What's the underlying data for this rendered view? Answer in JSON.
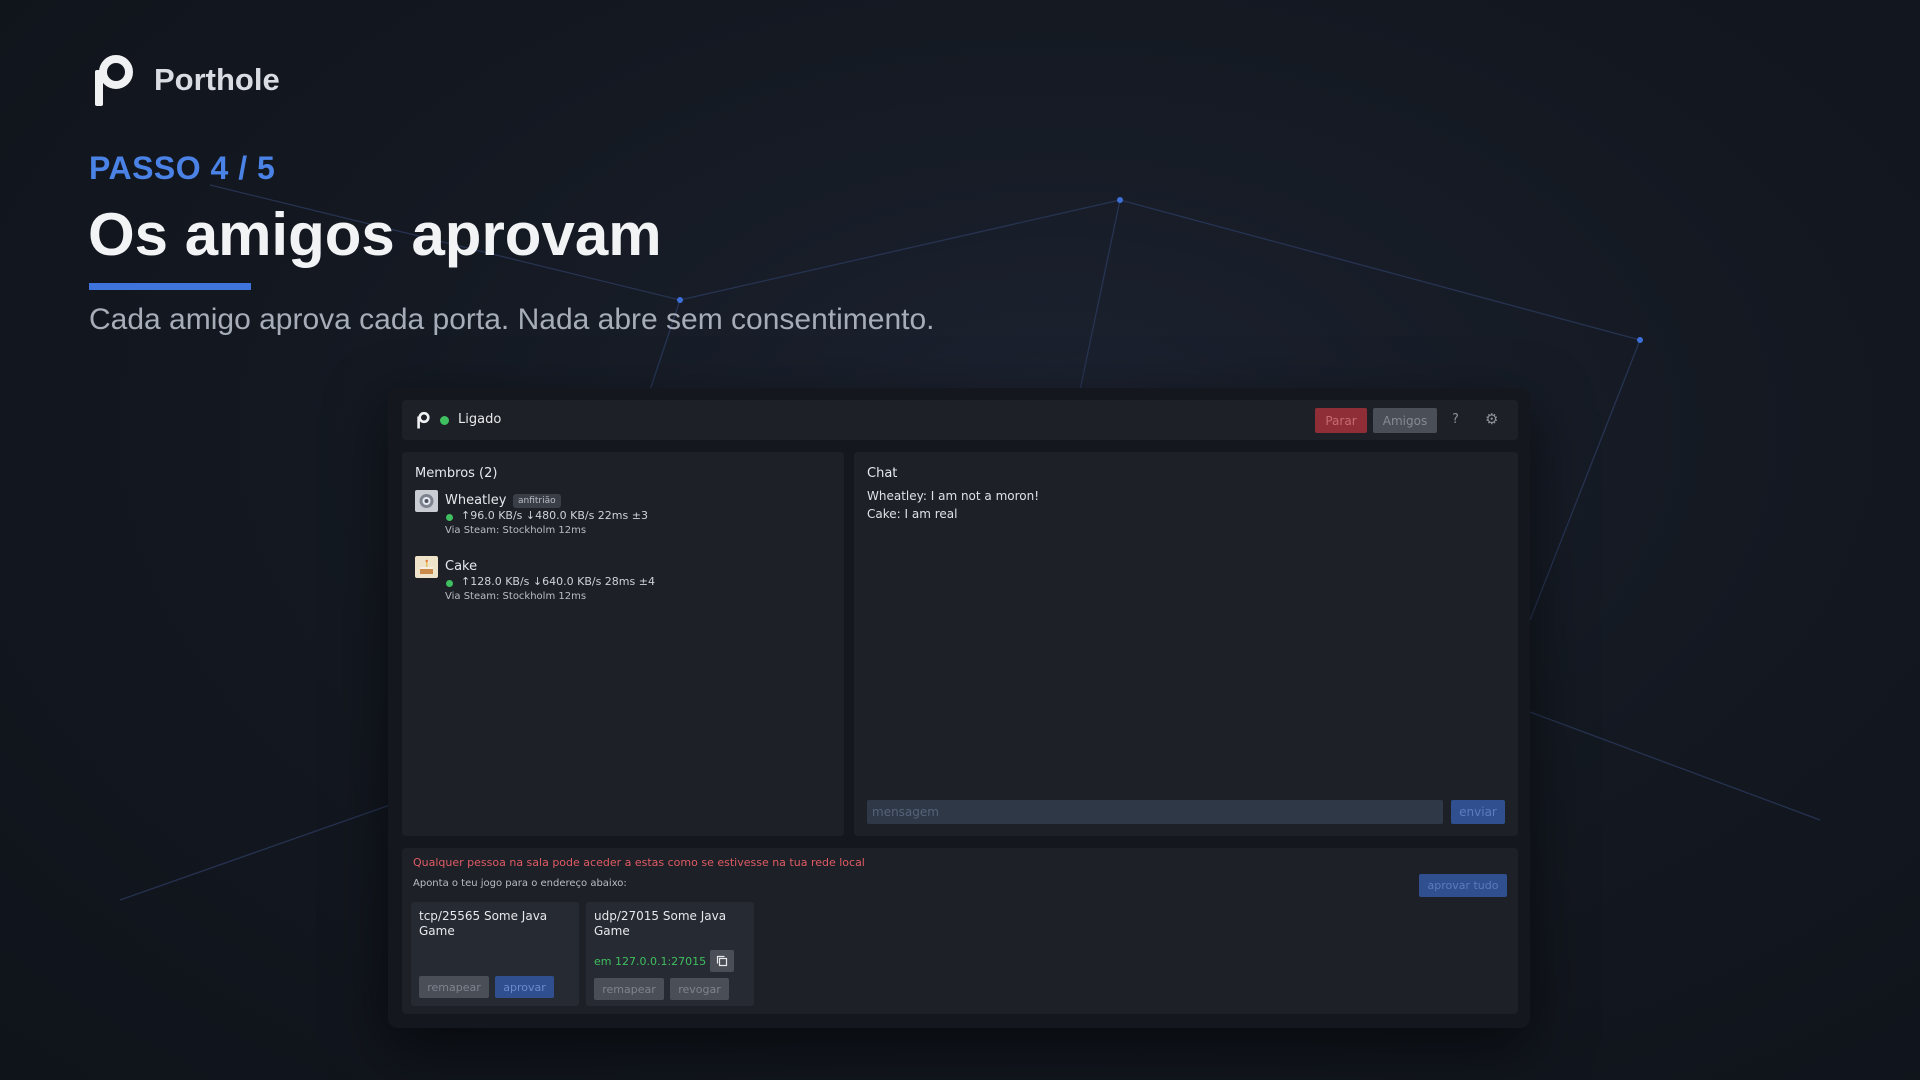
{
  "brand": {
    "name": "Porthole",
    "logo_icon": "porthole-p-logo"
  },
  "hero": {
    "step": "PASSO 4 / 5",
    "title": "Os amigos aprovam",
    "subtitle": "Cada amigo aprova cada porta. Nada abre sem consentimento."
  },
  "colors": {
    "accent": "#4a82e6",
    "online": "#3fbf5f",
    "danger": "#8f2e37",
    "warning_text": "#e05b63"
  },
  "app": {
    "topbar": {
      "status": "Ligado",
      "stop_label": "Parar",
      "friends_label": "Amigos",
      "help_label": "?",
      "settings_icon": "gear-icon"
    },
    "members": {
      "title": "Membros (2)",
      "list": [
        {
          "name": "Wheatley",
          "badge": "anfitrião",
          "stats": "↑96.0 KB/s ↓480.0 KB/s  22ms ±3",
          "via": "Via Steam: Stockholm 12ms",
          "avatar_icon": "wheatley-avatar"
        },
        {
          "name": "Cake",
          "badge": "",
          "stats": "↑128.0 KB/s ↓640.0 KB/s  28ms ±4",
          "via": "Via Steam: Stockholm 12ms",
          "avatar_icon": "cake-avatar"
        }
      ]
    },
    "chat": {
      "title": "Chat",
      "messages": [
        {
          "author": "Wheatley:",
          "text": "I am not a moron!"
        },
        {
          "author": "Cake:",
          "text": "I am real"
        }
      ],
      "input_placeholder": "mensagem",
      "send_label": "enviar"
    },
    "ports": {
      "warning": "Qualquer pessoa na sala pode aceder a estas como se estivesse na tua rede local",
      "hint": "Aponta o teu jogo para o endereço abaixo:",
      "approve_all_label": "aprovar tudo",
      "cards": [
        {
          "name": "tcp/25565 Some Java Game",
          "address": "",
          "remap_label": "remapear",
          "action_label": "aprovar"
        },
        {
          "name": "udp/27015 Some Java Game",
          "address": "em 127.0.0.1:27015",
          "remap_label": "remapear",
          "action_label": "revogar"
        }
      ]
    }
  }
}
